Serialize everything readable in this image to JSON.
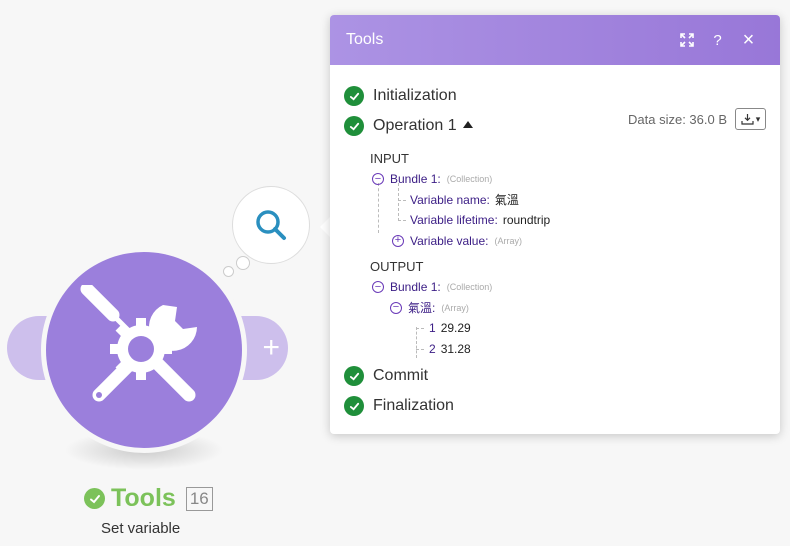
{
  "module": {
    "title": "Tools",
    "badge": "16",
    "subtitle": "Set variable",
    "status": "success",
    "color": "#9b7fdc",
    "icon": "tools-icon",
    "add_icon": "plus-icon",
    "inspect_icon": "search-icon"
  },
  "panel": {
    "title": "Tools",
    "header_buttons": [
      "expand-icon",
      "help-icon",
      "close-icon"
    ],
    "help_label": "?",
    "close_label": "×",
    "data_size_label": "Data size: 36.0 B",
    "steps": [
      {
        "label": "Initialization",
        "status": "success"
      },
      {
        "label": "Operation 1",
        "status": "success"
      },
      {
        "label": "Commit",
        "status": "success"
      },
      {
        "label": "Finalization",
        "status": "success"
      }
    ],
    "input": {
      "heading": "INPUT",
      "bundle_label": "Bundle 1:",
      "bundle_type": "(Collection)",
      "items": [
        {
          "key": "Variable name:",
          "value": "氣溫"
        },
        {
          "key": "Variable lifetime:",
          "value": "roundtrip"
        },
        {
          "key": "Variable value:",
          "type": "(Array)"
        }
      ]
    },
    "output": {
      "heading": "OUTPUT",
      "bundle_label": "Bundle 1:",
      "bundle_type": "(Collection)",
      "array_key": "氣溫:",
      "array_type": "(Array)",
      "values": [
        {
          "index": "1",
          "value": "29.29"
        },
        {
          "index": "2",
          "value": "31.28"
        }
      ]
    }
  }
}
